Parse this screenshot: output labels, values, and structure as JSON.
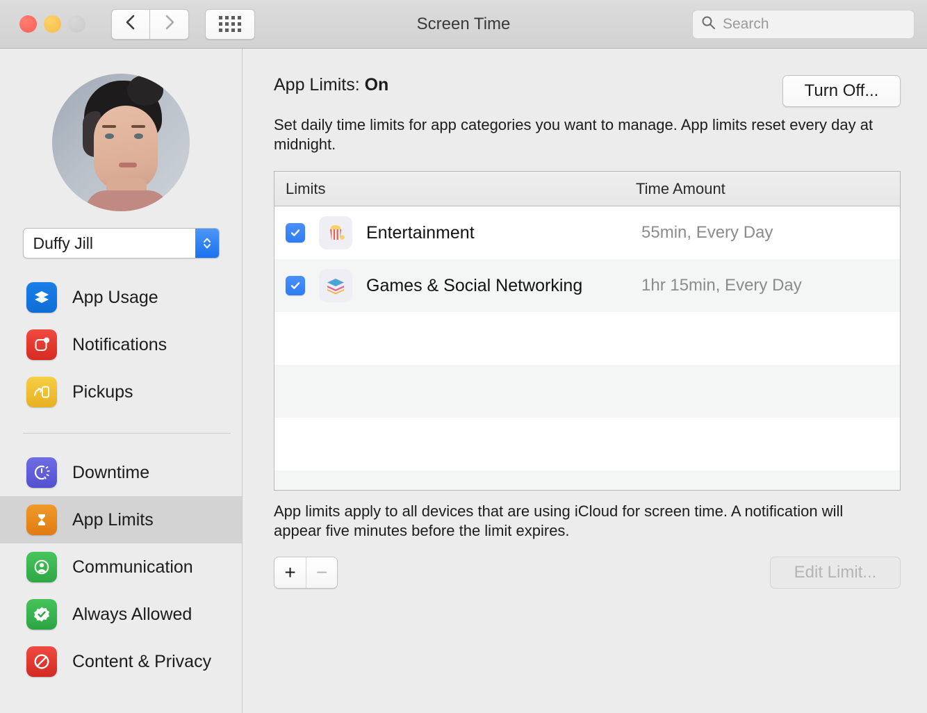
{
  "window": {
    "title": "Screen Time",
    "traffic_lights": [
      "close",
      "minimize",
      "zoom"
    ],
    "back_icon": "chevron-left-icon",
    "forward_icon": "chevron-right-icon",
    "grid_icon": "show-all-grid-icon"
  },
  "search": {
    "placeholder": "Search",
    "icon": "search-icon",
    "value": ""
  },
  "sidebar": {
    "avatar_alt": "user-avatar",
    "user": {
      "name": "Duffy Jill",
      "stepper_icon": "updown-chevrons-icon"
    },
    "items": [
      {
        "label": "App Usage",
        "icon": "app-usage-icon",
        "color": "#1a7fe8",
        "selected": false
      },
      {
        "label": "Notifications",
        "icon": "notifications-icon",
        "color": "#f04a40",
        "selected": false
      },
      {
        "label": "Pickups",
        "icon": "pickups-icon",
        "color": "#f6cf45",
        "selected": false
      },
      {
        "label": "Downtime",
        "icon": "downtime-icon",
        "color": "#6f6de2",
        "selected": false
      },
      {
        "label": "App Limits",
        "icon": "app-limits-icon",
        "color": "#f09a2a",
        "selected": true
      },
      {
        "label": "Communication",
        "icon": "communication-icon",
        "color": "#48c45c",
        "selected": false
      },
      {
        "label": "Always Allowed",
        "icon": "always-allowed-icon",
        "color": "#45c45a",
        "selected": false
      },
      {
        "label": "Content & Privacy",
        "icon": "content-privacy-icon",
        "color": "#ef4a40",
        "selected": false
      }
    ]
  },
  "main": {
    "status_prefix": "App Limits: ",
    "status_value": "On",
    "turn_off_label": "Turn Off...",
    "description": "Set daily time limits for app categories you want to manage. App limits reset every day at midnight.",
    "table": {
      "columns": [
        "Limits",
        "Time Amount"
      ],
      "rows": [
        {
          "checked": true,
          "icon": "popcorn-icon",
          "name": "Entertainment",
          "time": "55min, Every Day"
        },
        {
          "checked": true,
          "icon": "layers-stack-icon",
          "name": "Games & Social Networking",
          "time": "1hr 15min, Every Day"
        }
      ],
      "empty_rows": 4
    },
    "footnote": "App limits apply to all devices that are using iCloud for screen time. A notification will appear five minutes before the limit expires.",
    "add_label": "+",
    "remove_label": "−",
    "edit_label": "Edit Limit...",
    "edit_disabled": true,
    "remove_disabled": true
  },
  "colors": {
    "accent_blue": "#2d7cf3",
    "window_bg": "#ececec",
    "selected_row": "#d3d3d3",
    "muted_text": "#8b8b8b"
  }
}
